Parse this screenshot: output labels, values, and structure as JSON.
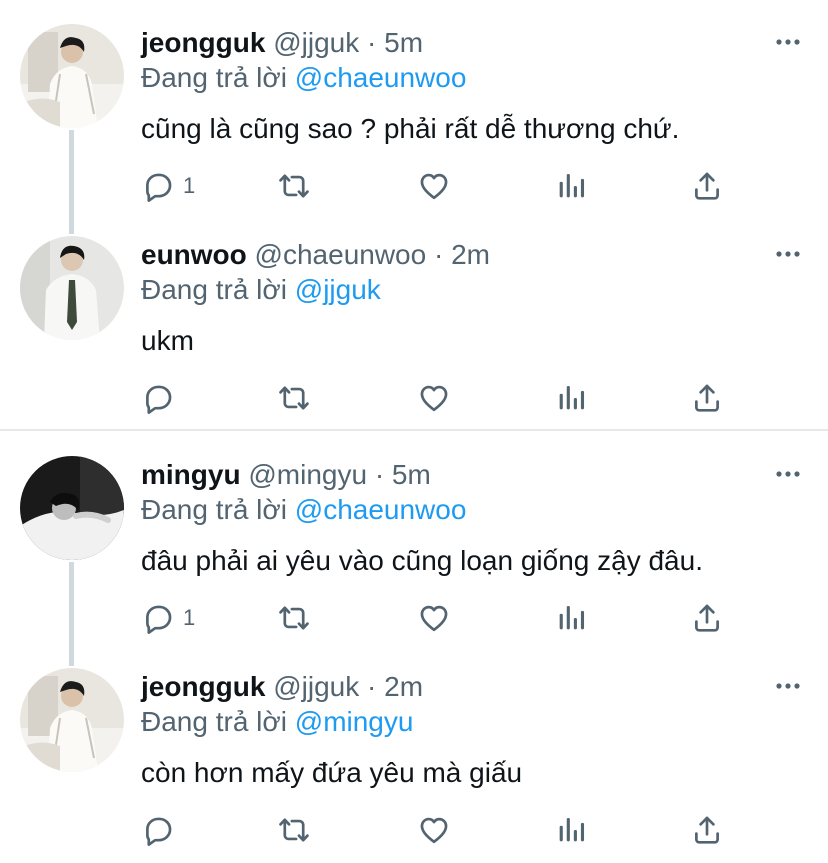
{
  "icons": {
    "reply": "reply-icon",
    "retweet": "retweet-icon",
    "like": "heart-icon",
    "analytics": "analytics-icon",
    "share": "share-icon",
    "more": "more-icon"
  },
  "colors": {
    "accent": "#1d9bf0",
    "muted": "#536471",
    "text": "#0f1419",
    "thread_line": "#cfd9de"
  },
  "threads": [
    {
      "tweets": [
        {
          "name": "jeongguk",
          "handle": "@jjguk",
          "sep": "·",
          "time": "5m",
          "reply_prefix": "Đang trả lời",
          "reply_to": "@chaeunwoo",
          "text": "cũng là cũng sao ? phải rất dễ thương chứ.",
          "reply_count": "1"
        },
        {
          "name": "eunwoo",
          "handle": "@chaeunwoo",
          "sep": "·",
          "time": "2m",
          "reply_prefix": "Đang trả lời",
          "reply_to": "@jjguk",
          "text": "ukm",
          "reply_count": ""
        }
      ]
    },
    {
      "tweets": [
        {
          "name": "mingyu",
          "handle": "@mingyu",
          "sep": "·",
          "time": "5m",
          "reply_prefix": "Đang trả lời",
          "reply_to": "@chaeunwoo",
          "text": "đâu phải ai yêu vào cũng loạn giống zậy đâu.",
          "reply_count": "1"
        },
        {
          "name": "jeongguk",
          "handle": "@jjguk",
          "sep": "·",
          "time": "2m",
          "reply_prefix": "Đang trả lời",
          "reply_to": "@mingyu",
          "text": "còn hơn mấy đứa yêu mà giấu",
          "reply_count": ""
        }
      ]
    }
  ]
}
